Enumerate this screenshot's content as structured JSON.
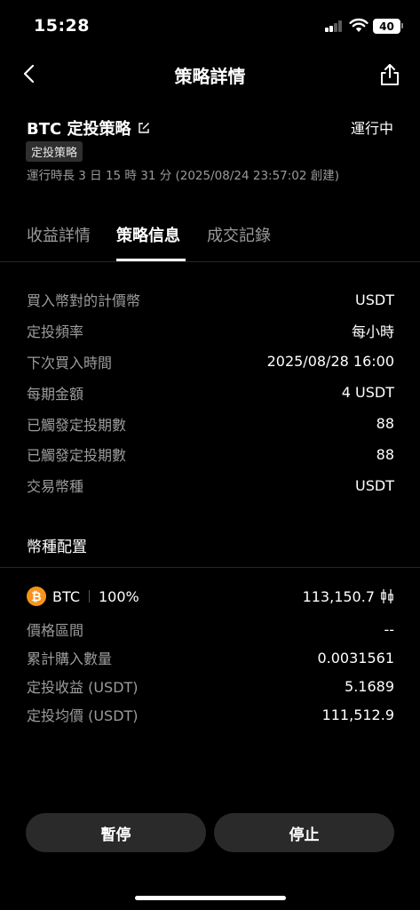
{
  "status_bar": {
    "time": "15:28",
    "battery": "40"
  },
  "nav": {
    "title": "策略詳情"
  },
  "strategy": {
    "name": "BTC 定投策略",
    "status": "運行中",
    "type_badge": "定投策略",
    "run_time": "運行時長 3 日 15 時 31 分 (2025/08/24 23:57:02 創建)"
  },
  "tabs": [
    {
      "label": "收益詳情"
    },
    {
      "label": "策略信息"
    },
    {
      "label": "成交記錄"
    }
  ],
  "info": [
    {
      "label": "買入幣對的計價幣",
      "value": "USDT"
    },
    {
      "label": "定投頻率",
      "value": "每小時"
    },
    {
      "label": "下次買入時間",
      "value": "2025/08/28 16:00"
    },
    {
      "label": "每期金額",
      "value": "4 USDT"
    },
    {
      "label": "已觸發定投期數",
      "value": "88"
    },
    {
      "label": "已觸發定投期數",
      "value": "88"
    },
    {
      "label": "交易幣種",
      "value": "USDT"
    }
  ],
  "allocation": {
    "title": "幣種配置",
    "coin": {
      "symbol": "BTC",
      "icon_glyph": "₿",
      "percent": "100%",
      "price": "113,150.7"
    },
    "details": [
      {
        "label": "價格區間",
        "value": "--"
      },
      {
        "label": "累計購入數量",
        "value": "0.0031561"
      },
      {
        "label": "定投收益 (USDT)",
        "value": "5.1689"
      },
      {
        "label": "定投均價 (USDT)",
        "value": "111,512.9"
      }
    ]
  },
  "buttons": {
    "pause": "暫停",
    "stop": "停止"
  },
  "colors": {
    "background": "#000000",
    "btc": "#f7931a",
    "button_bg": "#2a2a2a",
    "muted": "#9c9c9c"
  }
}
